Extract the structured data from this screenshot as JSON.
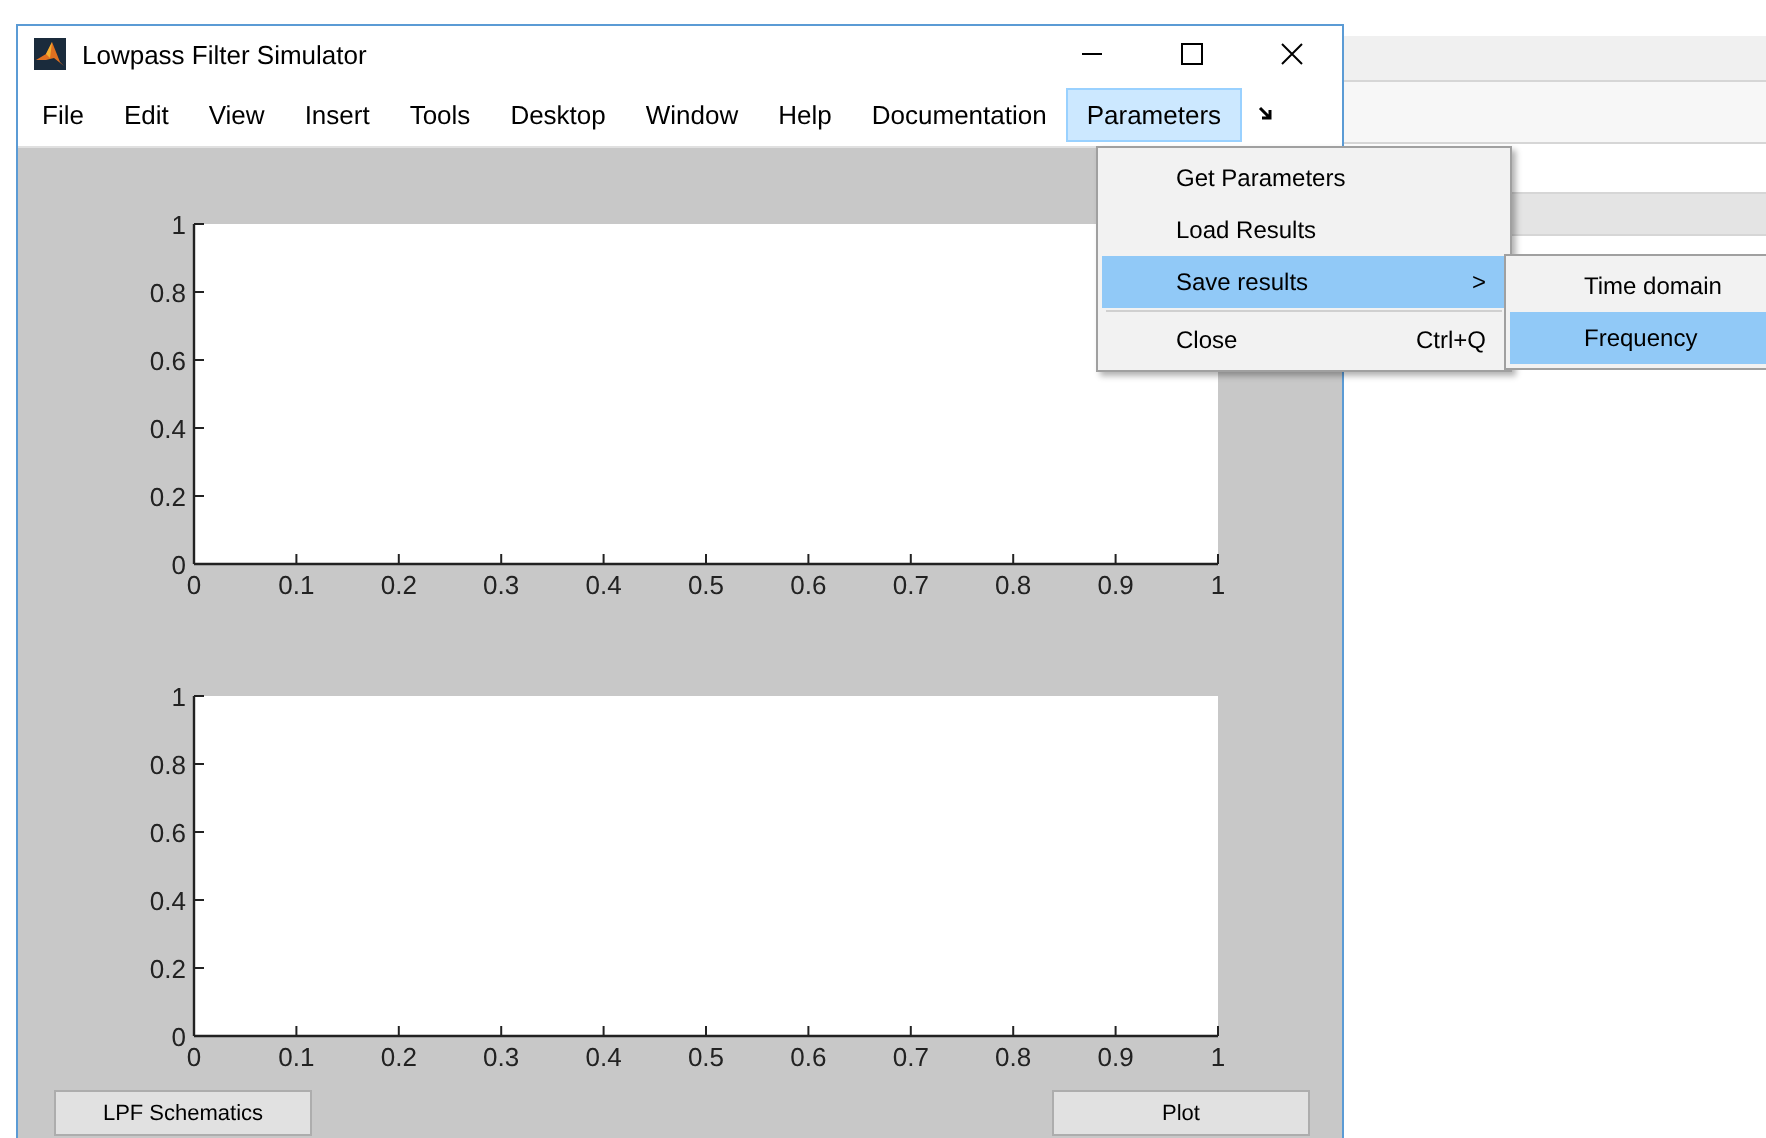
{
  "window": {
    "title": "Lowpass Filter Simulator"
  },
  "menu_bar": [
    {
      "label": "File",
      "selected": false
    },
    {
      "label": "Edit",
      "selected": false
    },
    {
      "label": "View",
      "selected": false
    },
    {
      "label": "Insert",
      "selected": false
    },
    {
      "label": "Tools",
      "selected": false
    },
    {
      "label": "Desktop",
      "selected": false
    },
    {
      "label": "Window",
      "selected": false
    },
    {
      "label": "Help",
      "selected": false
    },
    {
      "label": "Documentation",
      "selected": false
    },
    {
      "label": "Parameters",
      "selected": true
    }
  ],
  "parameters_menu": [
    {
      "label": "Get Parameters",
      "kind": "item",
      "selected": false
    },
    {
      "label": "Load Results",
      "kind": "item",
      "selected": false
    },
    {
      "label": "Save results",
      "kind": "submenu",
      "arrow": ">",
      "selected": true
    },
    {
      "label": "Close",
      "kind": "item",
      "shortcut": "Ctrl+Q",
      "selected": false
    }
  ],
  "save_results_submenu": [
    {
      "label": "Time domain",
      "selected": false
    },
    {
      "label": "Frequency",
      "selected": true
    }
  ],
  "axes": [
    {
      "chart_data": {
        "type": "line",
        "xlim": [
          0,
          1
        ],
        "ylim": [
          0,
          1
        ],
        "xticks": [
          {
            "value": 0,
            "label": "0"
          },
          {
            "value": 0.1,
            "label": "0.1"
          },
          {
            "value": 0.2,
            "label": "0.2"
          },
          {
            "value": 0.3,
            "label": "0.3"
          },
          {
            "value": 0.4,
            "label": "0.4"
          },
          {
            "value": 0.5,
            "label": "0.5"
          },
          {
            "value": 0.6,
            "label": "0.6"
          },
          {
            "value": 0.7,
            "label": "0.7"
          },
          {
            "value": 0.8,
            "label": "0.8"
          },
          {
            "value": 0.9,
            "label": "0.9"
          },
          {
            "value": 1,
            "label": "1"
          }
        ],
        "yticks": [
          {
            "value": 0,
            "label": "0"
          },
          {
            "value": 0.2,
            "label": "0.2"
          },
          {
            "value": 0.4,
            "label": "0.4"
          },
          {
            "value": 0.6,
            "label": "0.6"
          },
          {
            "value": 0.8,
            "label": "0.8"
          },
          {
            "value": 1,
            "label": "1"
          }
        ]
      }
    },
    {
      "chart_data": {
        "type": "line",
        "xlim": [
          0,
          1
        ],
        "ylim": [
          0,
          1
        ],
        "xticks": [
          {
            "value": 0,
            "label": "0"
          },
          {
            "value": 0.1,
            "label": "0.1"
          },
          {
            "value": 0.2,
            "label": "0.2"
          },
          {
            "value": 0.3,
            "label": "0.3"
          },
          {
            "value": 0.4,
            "label": "0.4"
          },
          {
            "value": 0.5,
            "label": "0.5"
          },
          {
            "value": 0.6,
            "label": "0.6"
          },
          {
            "value": 0.7,
            "label": "0.7"
          },
          {
            "value": 0.8,
            "label": "0.8"
          },
          {
            "value": 0.9,
            "label": "0.9"
          },
          {
            "value": 1,
            "label": "1"
          }
        ],
        "yticks": [
          {
            "value": 0,
            "label": "0"
          },
          {
            "value": 0.2,
            "label": "0.2"
          },
          {
            "value": 0.4,
            "label": "0.4"
          },
          {
            "value": 0.6,
            "label": "0.6"
          },
          {
            "value": 0.8,
            "label": "0.8"
          },
          {
            "value": 1,
            "label": "1"
          }
        ]
      }
    }
  ],
  "buttons": [
    {
      "label": "LPF Schematics"
    },
    {
      "label": "Plot"
    }
  ]
}
